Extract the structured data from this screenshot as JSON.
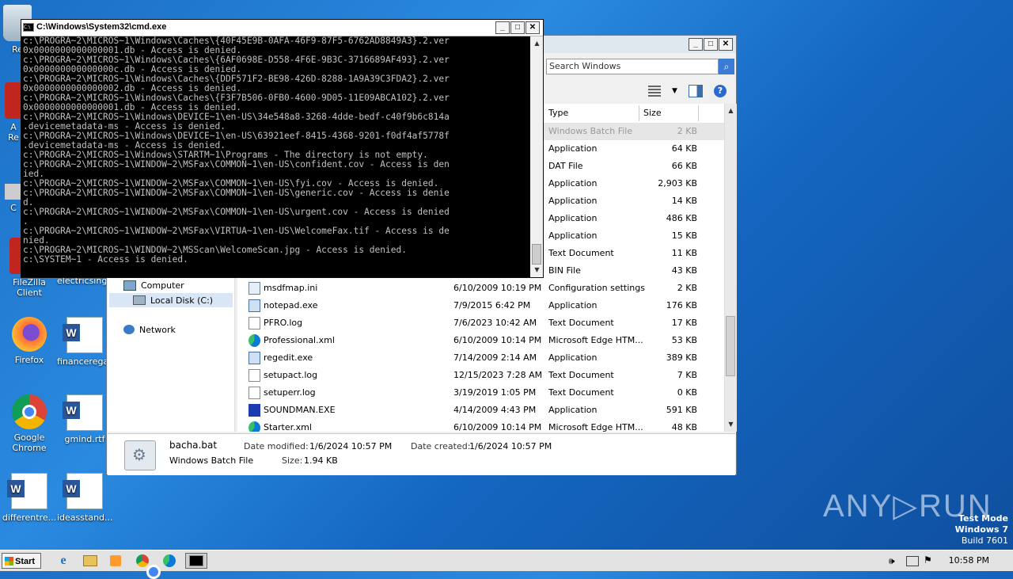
{
  "desktop": {
    "icons": [
      {
        "label": "FileZilla Client",
        "icon": "filezilla-icon"
      },
      {
        "label": "electricsingl...",
        "icon": "word-doc-icon"
      },
      {
        "label": "Firefox",
        "icon": "firefox-icon"
      },
      {
        "label": "financerega...",
        "icon": "word-doc-icon"
      },
      {
        "label": "Google Chrome",
        "icon": "chrome-icon"
      },
      {
        "label": "gmind.rtf",
        "icon": "word-doc-icon"
      },
      {
        "label": "differentre...",
        "icon": "word-doc-icon"
      },
      {
        "label": "ideasstand...",
        "icon": "word-doc-icon"
      },
      {
        "label": "Re",
        "icon": "recycle-bin-icon"
      },
      {
        "label": "A",
        "icon": "app-icon"
      },
      {
        "label": "Re",
        "icon": "app-icon"
      },
      {
        "label": "C",
        "icon": "app-icon"
      }
    ]
  },
  "cmd": {
    "title": "C:\\Windows\\System32\\cmd.exe",
    "lines": [
      "c:\\PROGRA~2\\MICROS~1\\Windows\\Caches\\{40F45E9B-0AFA-46F9-87F5-6762AD8849A3}.2.ver",
      "0x0000000000000001.db - Access is denied.",
      "c:\\PROGRA~2\\MICROS~1\\Windows\\Caches\\{6AF0698E-D558-4F6E-9B3C-3716689AF493}.2.ver",
      "0x000000000000000c.db - Access is denied.",
      "c:\\PROGRA~2\\MICROS~1\\Windows\\Caches\\{DDF571F2-BE98-426D-8288-1A9A39C3FDA2}.2.ver",
      "0x0000000000000002.db - Access is denied.",
      "c:\\PROGRA~2\\MICROS~1\\Windows\\Caches\\{F3F7B506-0FB0-4600-9D05-11E09ABCA102}.2.ver",
      "0x0000000000000001.db - Access is denied.",
      "c:\\PROGRA~2\\MICROS~1\\Windows\\DEVICE~1\\en-US\\34e548a8-3268-4dde-bedf-c40f9b6c814a",
      ".devicemetadata-ms - Access is denied.",
      "c:\\PROGRA~2\\MICROS~1\\Windows\\DEVICE~1\\en-US\\63921eef-8415-4368-9201-f0df4af5778f",
      ".devicemetadata-ms - Access is denied.",
      "c:\\PROGRA~2\\MICROS~1\\Windows\\STARTM~1\\Programs - The directory is not empty.",
      "c:\\PROGRA~2\\MICROS~1\\WINDOW~2\\MSFax\\COMMON~1\\en-US\\confident.cov - Access is den",
      "ied.",
      "c:\\PROGRA~2\\MICROS~1\\WINDOW~2\\MSFax\\COMMON~1\\en-US\\fyi.cov - Access is denied.",
      "c:\\PROGRA~2\\MICROS~1\\WINDOW~2\\MSFax\\COMMON~1\\en-US\\generic.cov - Access is denie",
      "d.",
      "c:\\PROGRA~2\\MICROS~1\\WINDOW~2\\MSFax\\COMMON~1\\en-US\\urgent.cov - Access is denied",
      ".",
      "c:\\PROGRA~2\\MICROS~1\\WINDOW~2\\MSFax\\VIRTUA~1\\en-US\\WelcomeFax.tif - Access is de",
      "nied.",
      "c:\\PROGRA~2\\MICROS~1\\WINDOW~2\\MSScan\\WelcomeScan.jpg - Access is denied.",
      "c:\\SYSTEM~1 - Access is denied."
    ]
  },
  "explorer": {
    "search_placeholder": "Search Windows",
    "columns": {
      "type": "Type",
      "size": "Size"
    },
    "nav": {
      "computer": "Computer",
      "local_disk": "Local Disk (C:)",
      "network": "Network"
    },
    "files": [
      {
        "name": "",
        "date": "",
        "type": "Windows Batch File",
        "size": "2 KB",
        "icon": "batch-file-icon",
        "selected": true
      },
      {
        "name": "",
        "date": "",
        "type": "Application",
        "size": "64 KB",
        "icon": "app-icon"
      },
      {
        "name": "",
        "date": "",
        "type": "DAT File",
        "size": "66 KB",
        "icon": "file-icon"
      },
      {
        "name": "",
        "date": "",
        "type": "Application",
        "size": "2,903 KB",
        "icon": "app-icon"
      },
      {
        "name": "",
        "date": "",
        "type": "Application",
        "size": "14 KB",
        "icon": "app-icon"
      },
      {
        "name": "",
        "date": "",
        "type": "Application",
        "size": "486 KB",
        "icon": "app-icon"
      },
      {
        "name": "",
        "date": "",
        "type": "Application",
        "size": "15 KB",
        "icon": "app-icon"
      },
      {
        "name": "",
        "date": "",
        "type": "Text Document",
        "size": "11 KB",
        "icon": "text-file-icon"
      },
      {
        "name": "",
        "date": "",
        "type": "BIN File",
        "size": "43 KB",
        "icon": "file-icon"
      },
      {
        "name": "msdfmap.ini",
        "date": "6/10/2009 10:19 PM",
        "type": "Configuration settings",
        "size": "2 KB",
        "icon": "config-file-icon"
      },
      {
        "name": "notepad.exe",
        "date": "7/9/2015 6:42 PM",
        "type": "Application",
        "size": "176 KB",
        "icon": "notepad-icon"
      },
      {
        "name": "PFRO.log",
        "date": "7/6/2023 10:42 AM",
        "type": "Text Document",
        "size": "17 KB",
        "icon": "text-file-icon"
      },
      {
        "name": "Professional.xml",
        "date": "6/10/2009 10:14 PM",
        "type": "Microsoft Edge HTM...",
        "size": "53 KB",
        "icon": "edge-icon"
      },
      {
        "name": "regedit.exe",
        "date": "7/14/2009 2:14 AM",
        "type": "Application",
        "size": "389 KB",
        "icon": "regedit-icon"
      },
      {
        "name": "setupact.log",
        "date": "12/15/2023 7:28 AM",
        "type": "Text Document",
        "size": "7 KB",
        "icon": "text-file-icon"
      },
      {
        "name": "setuperr.log",
        "date": "3/19/2019 1:05 PM",
        "type": "Text Document",
        "size": "0 KB",
        "icon": "text-file-icon"
      },
      {
        "name": "SOUNDMAN.EXE",
        "date": "4/14/2009 4:43 PM",
        "type": "Application",
        "size": "591 KB",
        "icon": "soundman-icon"
      },
      {
        "name": "Starter.xml",
        "date": "6/10/2009 10:14 PM",
        "type": "Microsoft Edge HTM...",
        "size": "48 KB",
        "icon": "edge-icon"
      }
    ],
    "details": {
      "filename": "bacha.bat",
      "filetype": "Windows Batch File",
      "modified_label": "Date modified:",
      "modified_value": "1/6/2024 10:57 PM",
      "created_label": "Date created:",
      "created_value": "1/6/2024 10:57 PM",
      "size_label": "Size:",
      "size_value": "1.94 KB"
    }
  },
  "taskbar": {
    "start_label": "Start",
    "clock": "10:58 PM",
    "apps": [
      "ie-icon",
      "explorer-icon",
      "media-player-icon",
      "chrome-icon",
      "edge-icon",
      "cmd-icon"
    ]
  },
  "watermark": {
    "text": "ANY▷RUN"
  },
  "os": {
    "line1": "Test Mode",
    "line2": "Windows 7",
    "line3": "Build 7601"
  },
  "colors": {
    "accent": "#3a7bd5",
    "desktop": "#1b6fc4",
    "cmd_bg": "#000000",
    "cmd_text": "#c0c0c0"
  }
}
